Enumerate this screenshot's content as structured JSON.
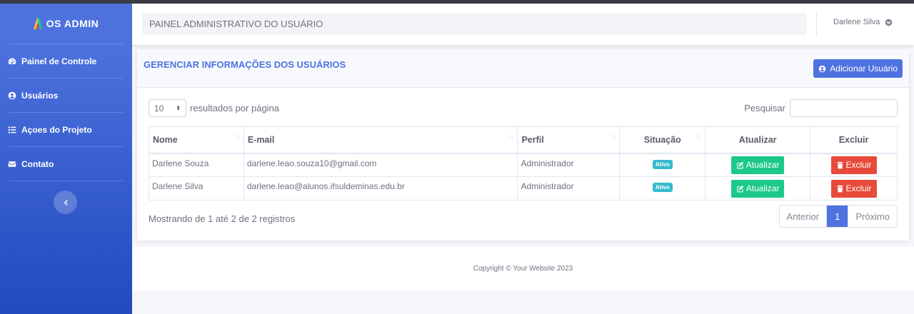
{
  "brand": {
    "name": "OS ADMIN"
  },
  "sidebar": {
    "items": [
      {
        "label": "Painel de Controle",
        "icon": "tachometer-icon"
      },
      {
        "label": "Usuários",
        "icon": "user-circle-icon"
      },
      {
        "label": "Açoes do Projeto",
        "icon": "list-icon"
      },
      {
        "label": "Contato",
        "icon": "envelope-icon"
      }
    ],
    "toggle_icon": "chevron-left-icon"
  },
  "header": {
    "title": "PAINEL ADMINISTRATIVO DO USUÁRIO",
    "user_name": "Darlene Silva",
    "user_icon": "chevron-circle-down-icon"
  },
  "card": {
    "title": "GERENCIAR INFORMAÇÕES DOS USUÁRIOS",
    "add_button": "Adicionar Usuário",
    "length_value": "10",
    "length_label": "resultados por página",
    "search_label": "Pesquisar",
    "search_value": ""
  },
  "table": {
    "columns": [
      "Nome",
      "E-mail",
      "Perfil",
      "Situação",
      "Atualizar",
      "Excluir"
    ],
    "rows": [
      {
        "nome": "Darlene Souza",
        "email": "darlene.leao.souza10@gmail.com",
        "perfil": "Administrador",
        "situacao": "Ativo",
        "atualizar": "Atualizar",
        "excluir": "Excluir"
      },
      {
        "nome": "Darlene Silva",
        "email": "darlene.leao@alunos.ifsuldeminas.edu.br",
        "perfil": "Administrador",
        "situacao": "Ativo",
        "atualizar": "Atualizar",
        "excluir": "Excluir"
      }
    ]
  },
  "info": "Mostrando de 1 até 2 de 2 registros",
  "pagination": {
    "previous": "Anterior",
    "current": "1",
    "next": "Próximo"
  },
  "footer": {
    "copyright": "Copyright © Your Website 2023"
  },
  "colors": {
    "primary": "#4e73df",
    "success": "#1cc88a",
    "danger": "#e74a3b",
    "info": "#36b9cc"
  }
}
